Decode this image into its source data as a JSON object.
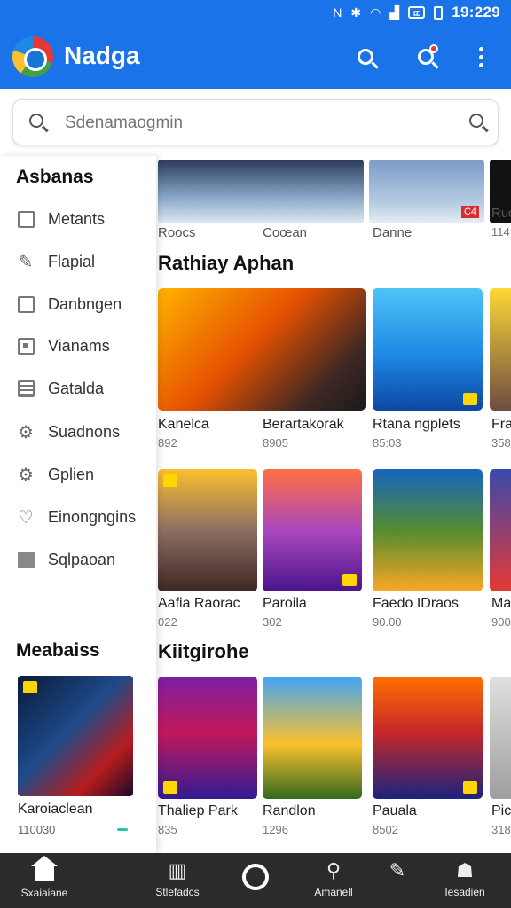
{
  "status_bar": {
    "icons": [
      "nfc-icon",
      "bluetooth-icon",
      "wifi-icon",
      "signal-icon",
      "battery-icon"
    ],
    "battery_text": "ㄸ",
    "time": "19:229"
  },
  "app_bar": {
    "title": "Nadga",
    "actions": [
      "search-icon",
      "notification-search-icon",
      "more-vert-icon"
    ]
  },
  "search": {
    "placeholder": "Sdenamaogmin"
  },
  "sidebar": {
    "heading": "Asbanas",
    "items": [
      {
        "icon": "square-icon",
        "label": "Metants"
      },
      {
        "icon": "pencil-icon",
        "label": "Flapial"
      },
      {
        "icon": "checkbox-icon",
        "label": "Danbngen"
      },
      {
        "icon": "square-dot-icon",
        "label": "Vianams"
      },
      {
        "icon": "list-icon",
        "label": "Gatalda"
      },
      {
        "icon": "gear-icon",
        "label": "Suadnons"
      },
      {
        "icon": "gear-icon",
        "label": "Gplien"
      },
      {
        "icon": "heart-icon",
        "label": "Einongngins"
      },
      {
        "icon": "folder-icon",
        "label": "Sqlpaoan"
      }
    ],
    "featured_heading": "Meabaiss",
    "featured": {
      "name": "Karoiaclean",
      "meta": "110030"
    }
  },
  "top_strip": {
    "labels": [
      "Roocs",
      "Coœan",
      "Danne",
      "Ruq"
    ],
    "metas": [
      "114"
    ],
    "badge": "C4"
  },
  "sections": [
    {
      "title": "Rathiay Aphan",
      "cards": [
        {
          "name": "Kanelca",
          "meta": "892"
        },
        {
          "name": "Berartakorak",
          "meta": "8905"
        },
        {
          "name": "Rtana ngplets",
          "meta": "85:03"
        },
        {
          "name": "Fra",
          "meta": "358"
        }
      ]
    },
    {
      "title": "",
      "cards": [
        {
          "name": "Aafia Raorac",
          "meta": "022"
        },
        {
          "name": "Paroila",
          "meta": "302"
        },
        {
          "name": "Faedo IDraos",
          "meta": "90.00"
        },
        {
          "name": "Ma",
          "meta": "900"
        }
      ]
    },
    {
      "title": "Kiitgirohe",
      "cards": [
        {
          "name": "Thaliep Park",
          "meta": "835"
        },
        {
          "name": "Randlon",
          "meta": "1296"
        },
        {
          "name": "Pauala",
          "meta": "8502"
        },
        {
          "name": "Pic",
          "meta": "318"
        }
      ]
    }
  ],
  "bottom_nav": [
    {
      "icon": "home-icon",
      "label": "Sxaiaiane"
    },
    {
      "icon": "stats-icon",
      "label": "Stlefadcs"
    },
    {
      "icon": "circle-icon",
      "label": ""
    },
    {
      "icon": "search-icon",
      "label": "Amanell"
    },
    {
      "icon": "pencil-icon",
      "label": ""
    },
    {
      "icon": "profile-icon",
      "label": "Iesadien"
    }
  ],
  "colors": {
    "accent": "#1a73e8",
    "nav_background": "#2b2b2b"
  }
}
